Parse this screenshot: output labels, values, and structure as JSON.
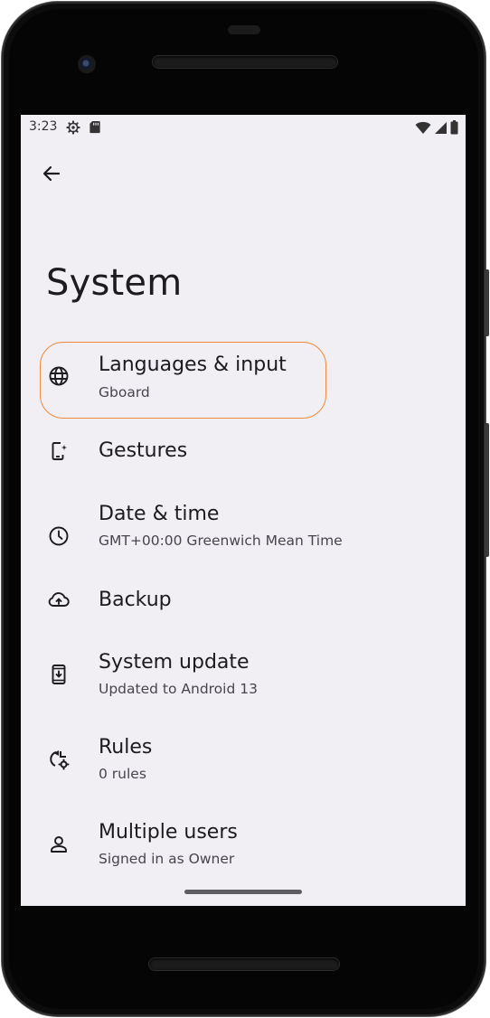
{
  "status_bar": {
    "time": "3:23",
    "icons": [
      "settings-gear-icon",
      "sd-card-icon",
      "wifi-icon",
      "cell-signal-icon",
      "battery-icon"
    ]
  },
  "header": {
    "back_icon": "arrow-back-icon",
    "title": "System"
  },
  "settings": {
    "items": [
      {
        "icon": "globe-icon",
        "title": "Languages & input",
        "subtitle": "Gboard",
        "highlighted": true
      },
      {
        "icon": "gestures-phone-icon",
        "title": "Gestures",
        "subtitle": ""
      },
      {
        "icon": "clock-icon",
        "title": "Date & time",
        "subtitle": "GMT+00:00 Greenwich Mean Time"
      },
      {
        "icon": "cloud-upload-icon",
        "title": "Backup",
        "subtitle": ""
      },
      {
        "icon": "system-update-icon",
        "title": "System update",
        "subtitle": "Updated to Android 13"
      },
      {
        "icon": "rules-icon",
        "title": "Rules",
        "subtitle": "0 rules"
      },
      {
        "icon": "person-icon",
        "title": "Multiple users",
        "subtitle": "Signed in as Owner"
      }
    ]
  },
  "colors": {
    "screen_background": "#f1eef4",
    "highlight_outline": "#f08a3a",
    "text_primary": "#1c1b1f",
    "text_secondary": "#49454f"
  }
}
